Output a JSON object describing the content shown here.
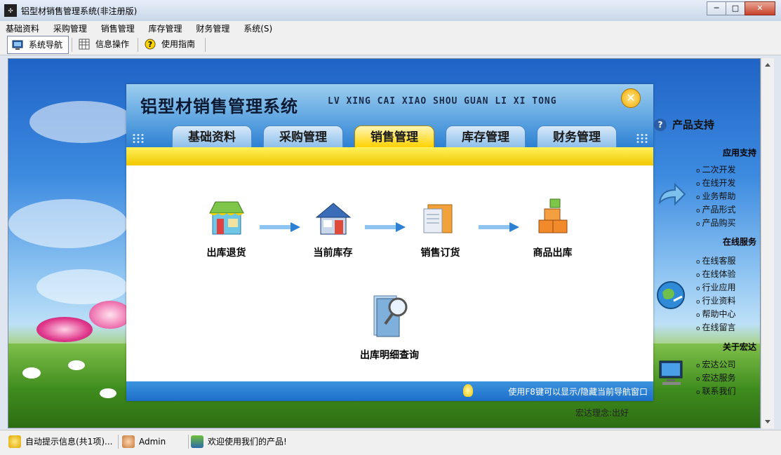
{
  "window": {
    "title": "铝型材销售管理系统(非注册版)",
    "min": "─",
    "max": "□",
    "close": "✕"
  },
  "menu": [
    "基础资料",
    "采购管理",
    "销售管理",
    "库存管理",
    "财务管理",
    "系统(S)"
  ],
  "toolbar": {
    "nav": "系统导航",
    "info": "信息操作",
    "guide": "使用指南"
  },
  "dialog": {
    "title": "铝型材销售管理系统",
    "pinyin": "LV XING CAI XIAO SHOU GUAN LI XI TONG",
    "tabs": [
      "基础资料",
      "采购管理",
      "销售管理",
      "库存管理",
      "财务管理"
    ],
    "active_tab": "销售管理",
    "nodes": [
      "出库退货",
      "当前库存",
      "销售订货",
      "商品出库",
      "出库明细查询"
    ],
    "hint": "使用F8键可以显示/隐藏当前导航窗口"
  },
  "side": {
    "support_title": "产品支持",
    "sections": [
      {
        "title": "应用支持",
        "items": [
          "二次开发",
          "在线开发",
          "业务帮助",
          "产品形式",
          "产品购买"
        ]
      },
      {
        "title": "在线服务",
        "items": [
          "在线客服",
          "在线体验",
          "行业应用",
          "行业资料",
          "帮助中心",
          "在线留言"
        ]
      },
      {
        "title": "关于宏达",
        "items": [
          "宏达公司",
          "宏达服务",
          "联系我们"
        ]
      }
    ],
    "motto": "宏达理念:出好"
  },
  "status": {
    "tips": "自动提示信息(共1项)...",
    "user": "Admin",
    "welcome": "欢迎使用我们的产品!"
  },
  "colors": {
    "accent": "#2d80d2",
    "tab_active": "#ffd200"
  }
}
